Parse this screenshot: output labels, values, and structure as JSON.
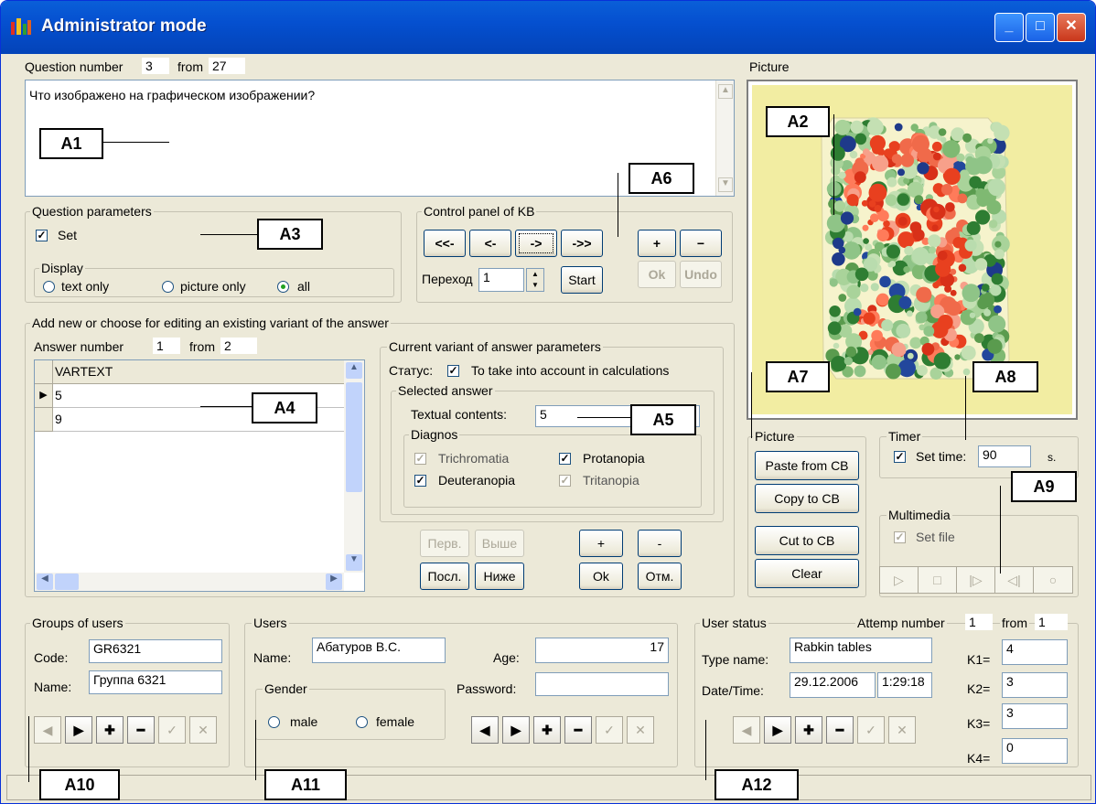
{
  "window": {
    "title": "Administrator mode"
  },
  "question": {
    "label": "Question number",
    "number": "3",
    "from_label": "from",
    "total": "27",
    "text": "Что изображено на графическом изображении?"
  },
  "picture": {
    "label": "Picture"
  },
  "qparams": {
    "title": "Question parameters",
    "set_label": "Set",
    "display_title": "Display",
    "opt_text": "text only",
    "opt_picture": "picture only",
    "opt_all": "all"
  },
  "control": {
    "title": "Control panel of KB",
    "first": "<<-",
    "prev": "<-",
    "next": "->",
    "last": "->>",
    "plus": "+",
    "minus": "−",
    "ok": "Ok",
    "undo": "Undo",
    "goto_label": "Переход",
    "goto_value": "1",
    "start": "Start"
  },
  "answers": {
    "title": "Add new or choose for editing an existing variant of the answer",
    "number_label": "Answer number",
    "number": "1",
    "from_label": "from",
    "total": "2",
    "column": "VARTEXT",
    "rows": [
      "5",
      "9"
    ],
    "btn_first": "Перв.",
    "btn_up": "Выше",
    "btn_last": "Посл.",
    "btn_down": "Ниже",
    "btn_plus": "+",
    "btn_minus": "-",
    "btn_ok": "Ok",
    "btn_cancel": "Отм."
  },
  "variant": {
    "title": "Current variant of answer parameters",
    "status_label": "Статус:",
    "status_text": "To take into account in calculations",
    "selected_title": "Selected answer",
    "textual_label": "Textual contents:",
    "textual_value": "5",
    "diag_title": "Diagnos",
    "trichromatia": "Trichromatia",
    "protanopia": "Protanopia",
    "deuteranopia": "Deuteranopia",
    "tritanopia": "Tritanopia"
  },
  "picture_panel": {
    "title": "Picture",
    "paste": "Paste from CB",
    "copy": "Copy to CB",
    "cut": "Cut to CB",
    "clear": "Clear"
  },
  "timer": {
    "title": "Timer",
    "set_label": "Set time:",
    "value": "90",
    "unit": "s."
  },
  "multimedia": {
    "title": "Multimedia",
    "set_label": "Set file"
  },
  "groups": {
    "title": "Groups of users",
    "code_label": "Code:",
    "code": "GR6321",
    "name_label": "Name:",
    "name": "Группа 6321"
  },
  "users": {
    "title": "Users",
    "name_label": "Name:",
    "name": "Абатуров В.С.",
    "age_label": "Age:",
    "age": "17",
    "password_label": "Password:",
    "gender_title": "Gender",
    "male": "male",
    "female": "female"
  },
  "status": {
    "title": "User status",
    "attempt_label": "Attemp number",
    "attempt": "1",
    "from_label": "from",
    "attempt_total": "1",
    "type_label": "Type name:",
    "type": "Rabkin tables",
    "dt_label": "Date/Time:",
    "date": "29.12.2006",
    "time": "1:29:18",
    "k1_label": "K1=",
    "k1": "4",
    "k2_label": "K2=",
    "k2": "3",
    "k3_label": "K3=",
    "k3": "3",
    "k4_label": "K4=",
    "k4": "0"
  },
  "annotations": {
    "a1": "A1",
    "a2": "A2",
    "a3": "A3",
    "a4": "A4",
    "a5": "A5",
    "a6": "A6",
    "a7": "A7",
    "a8": "A8",
    "a9": "A9",
    "a10": "A10",
    "a11": "A11",
    "a12": "A12"
  }
}
